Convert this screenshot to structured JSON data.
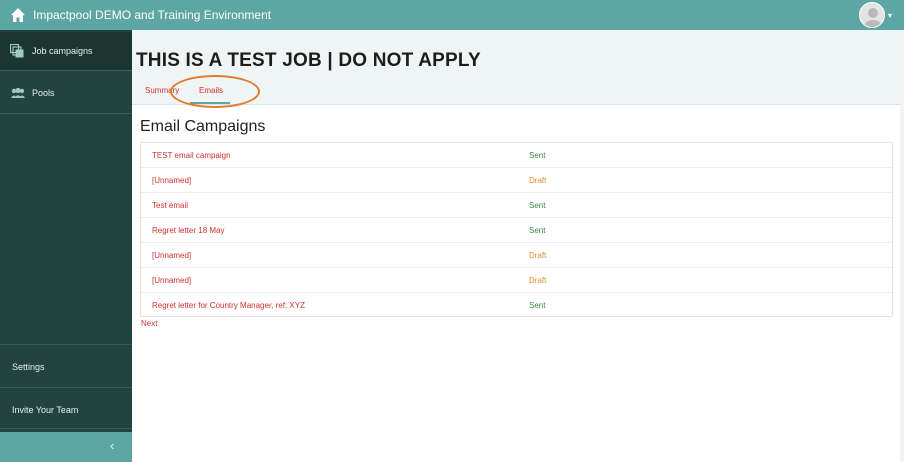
{
  "topbar": {
    "app_title": "Impactpool DEMO and Training Environment",
    "home_icon": "home-icon",
    "avatar_icon": "user-avatar",
    "caret_glyph": "▾"
  },
  "sidebar": {
    "items": [
      {
        "label": "Job campaigns",
        "icon": "job-campaigns-icon"
      },
      {
        "label": "Pools",
        "icon": "pools-icon"
      }
    ],
    "settings_label": "Settings",
    "invite_label": "Invite Your Team",
    "collapse_glyph": "‹"
  },
  "job": {
    "title": "THIS IS A TEST JOB | DO NOT APPLY"
  },
  "tabs": [
    {
      "label": "Summary"
    },
    {
      "label": "Emails"
    }
  ],
  "emails": {
    "section_title": "Email Campaigns",
    "rows": [
      {
        "name": "TEST email campaign",
        "status": "Sent"
      },
      {
        "name": "[Unnamed]",
        "status": "Draft"
      },
      {
        "name": "Test email",
        "status": "Sent"
      },
      {
        "name": "Regret letter 18 May",
        "status": "Sent"
      },
      {
        "name": "[Unnamed]",
        "status": "Draft"
      },
      {
        "name": "[Unnamed]",
        "status": "Draft"
      },
      {
        "name": "Regret letter for Country Manager, ref: XYZ",
        "status": "Sent"
      }
    ],
    "next_label": "Next"
  },
  "colors": {
    "topbar": "#5ea6a3",
    "sidebar": "#23433e",
    "link_red": "#d0312d",
    "sent_green": "#3a8a3a",
    "draft_orange": "#e08e2b",
    "highlight_oval": "#e07b2c"
  }
}
